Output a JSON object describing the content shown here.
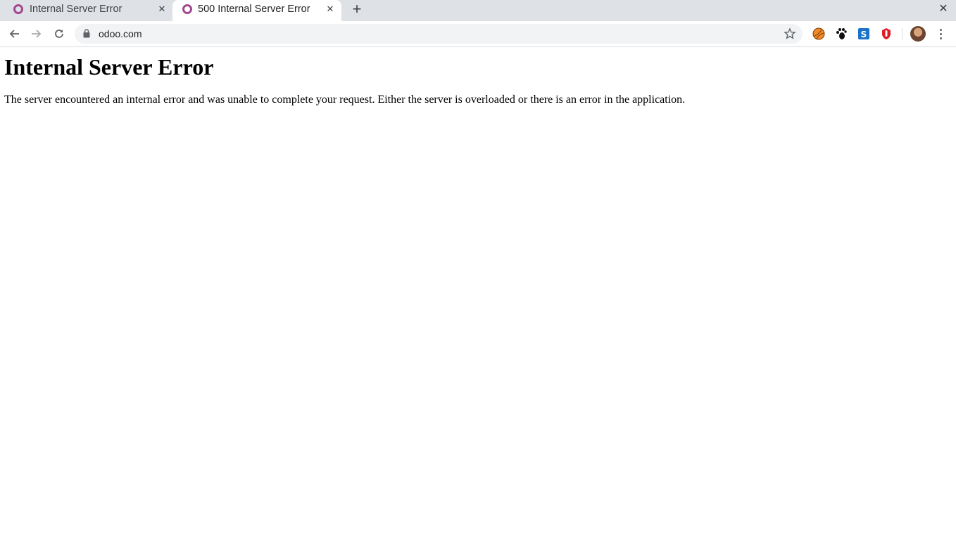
{
  "tabs": [
    {
      "title": "Internal Server Error",
      "active": false,
      "favicon": "odoo-ring-icon"
    },
    {
      "title": "500 Internal Server Error",
      "active": true,
      "favicon": "odoo-ring-icon"
    }
  ],
  "toolbar": {
    "url": "odoo.com",
    "extensions": [
      "orange-ball-extension-icon",
      "paw-extension-icon",
      "s-blue-extension-icon",
      "red-hand-extension-icon"
    ]
  },
  "page": {
    "heading": "Internal Server Error",
    "message": "The server encountered an internal error and was unable to complete your request. Either the server is overloaded or there is an error in the application."
  },
  "colors": {
    "favicon": "#a3488f",
    "tabstrip": "#dee1e6",
    "omnibox": "#f1f3f4"
  }
}
